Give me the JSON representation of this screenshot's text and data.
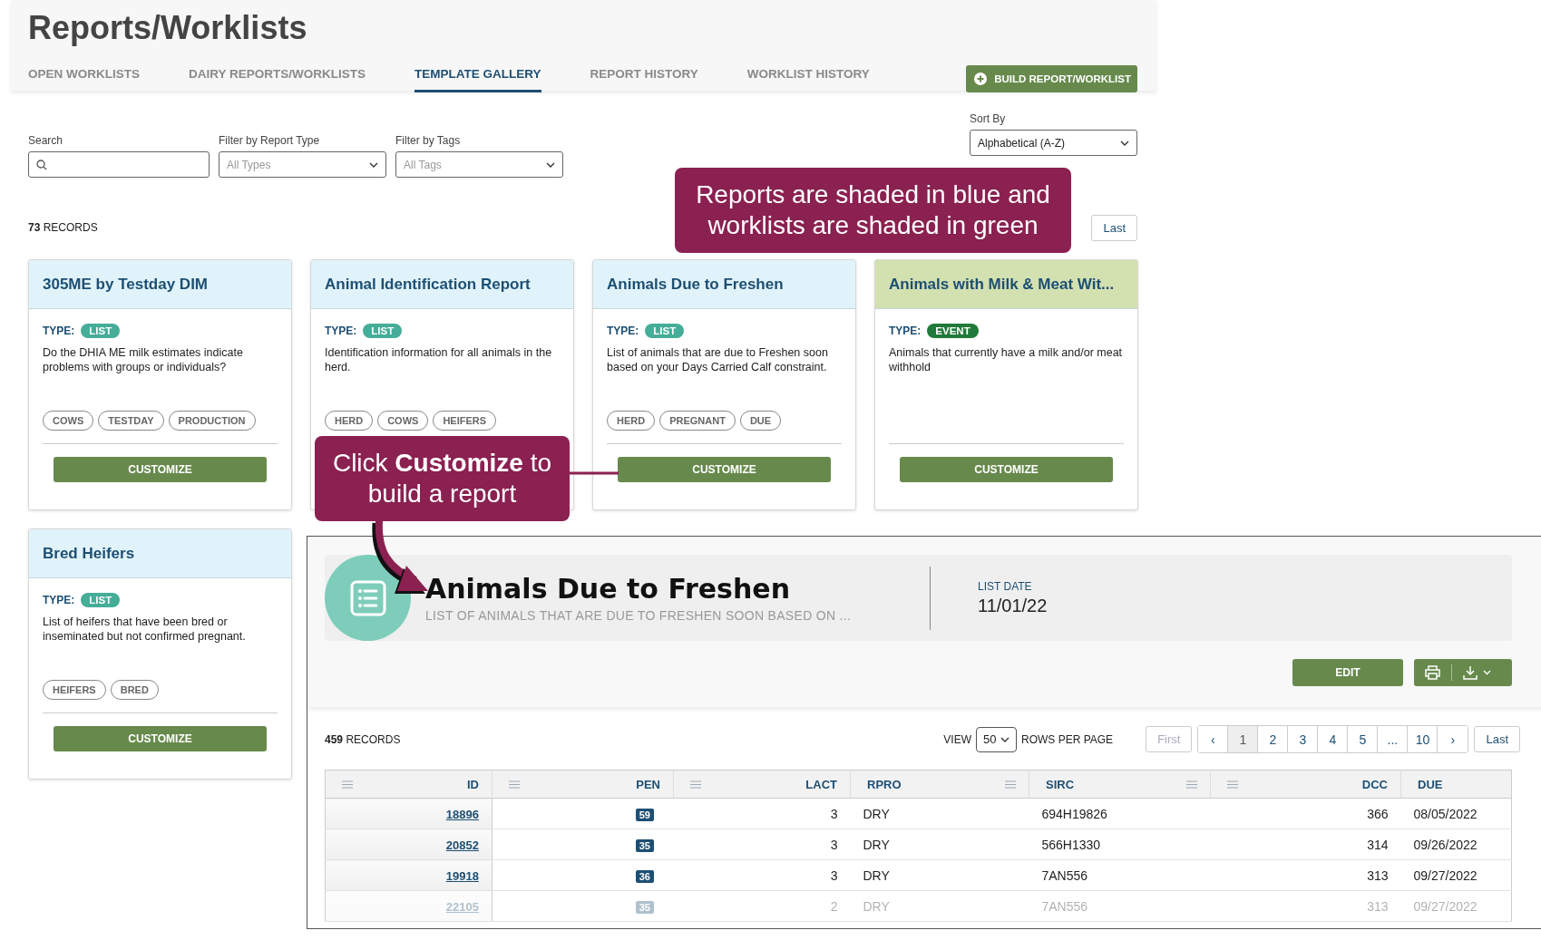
{
  "page": {
    "title": "Reports/Worklists"
  },
  "tabs": [
    {
      "label": "OPEN WORKLISTS",
      "selected": false
    },
    {
      "label": "DAIRY REPORTS/WORKLISTS",
      "selected": false
    },
    {
      "label": "TEMPLATE GALLERY",
      "selected": true
    },
    {
      "label": "REPORT HISTORY",
      "selected": false
    },
    {
      "label": "WORKLIST HISTORY",
      "selected": false
    }
  ],
  "build_button": "BUILD REPORT/WORKLIST",
  "filters": {
    "search": {
      "label": "Search"
    },
    "report_type": {
      "label": "Filter by Report Type",
      "value": "All Types"
    },
    "tags": {
      "label": "Filter by Tags",
      "value": "All Tags"
    },
    "sort": {
      "label": "Sort By",
      "value": "Alphabetical (A-Z)"
    }
  },
  "records": {
    "count": "73",
    "label": "RECORDS"
  },
  "pagination": [
    {
      "label": "Last"
    }
  ],
  "cards": [
    {
      "title": "305ME by Testday DIM",
      "kind": "report",
      "type_label": "TYPE:",
      "type": {
        "label": "LIST",
        "kind": "list"
      },
      "description": "Do the DHIA ME milk estimates indicate problems with groups or individuals?",
      "tags": [
        "COWS",
        "TESTDAY",
        "PRODUCTION"
      ],
      "button": "CUSTOMIZE"
    },
    {
      "title": "Animal Identification Report",
      "kind": "report",
      "type_label": "TYPE:",
      "type": {
        "label": "LIST",
        "kind": "list"
      },
      "description": "Identification information for all animals in the herd.",
      "tags": [
        "HERD",
        "COWS",
        "HEIFERS"
      ]
    },
    {
      "title": "Animals Due to Freshen",
      "kind": "report",
      "type_label": "TYPE:",
      "type": {
        "label": "LIST",
        "kind": "list"
      },
      "description": "List of animals that are due to Freshen soon based on your Days Carried Calf constraint.",
      "tags": [
        "HERD",
        "PREGNANT",
        "DUE"
      ],
      "button": "CUSTOMIZE"
    },
    {
      "title": "Animals with Milk & Meat Wit...",
      "kind": "worklist",
      "type_label": "TYPE:",
      "type": {
        "label": "EVENT",
        "kind": "event"
      },
      "description": "Animals that currently have a milk and/or meat withhold",
      "button": "CUSTOMIZE"
    },
    {
      "title": "Bred Heifers",
      "kind": "report",
      "type_label": "TYPE:",
      "type": {
        "label": "LIST",
        "kind": "list"
      },
      "description": "List of heifers that have been bred or inseminated but not confirmed pregnant.",
      "tags": [
        "HEIFERS",
        "BRED"
      ],
      "button": "CUSTOMIZE"
    }
  ],
  "detail_panel": {
    "title": "Animals Due to Freshen",
    "subtitle": "LIST OF ANIMALS THAT ARE DUE TO FRESHEN SOON BASED ON ...",
    "list_date": {
      "label": "LIST DATE",
      "value": "11/01/22"
    },
    "edit_button": "EDIT",
    "records": {
      "count": "459",
      "label": "RECORDS"
    },
    "view": {
      "label": "VIEW",
      "value": "50",
      "suffix": "ROWS PER PAGE"
    },
    "first_button": {
      "label": "First",
      "disabled": true
    },
    "pages": [
      {
        "label": "‹",
        "selected": false
      },
      {
        "label": "1",
        "selected": true
      },
      {
        "label": "2",
        "selected": false
      },
      {
        "label": "3",
        "selected": false
      },
      {
        "label": "4",
        "selected": false
      },
      {
        "label": "5",
        "selected": false
      },
      {
        "label": "...",
        "selected": false
      },
      {
        "label": "10",
        "selected": false
      },
      {
        "label": "›",
        "selected": false
      }
    ],
    "last_button": {
      "label": "Last",
      "disabled": false
    },
    "table": {
      "columns": [
        {
          "label": "ID",
          "kind": "number",
          "menu": true
        },
        {
          "label": "PEN",
          "kind": "number",
          "menu": true
        },
        {
          "label": "LACT",
          "kind": "number",
          "menu": true
        },
        {
          "label": "RPRO",
          "kind": "text",
          "menu": true
        },
        {
          "label": "SIRC",
          "kind": "text",
          "menu": true
        },
        {
          "label": "DCC",
          "kind": "number",
          "menu": true
        },
        {
          "label": "DUE",
          "kind": "text",
          "menu": false
        }
      ],
      "rows": [
        {
          "cells": [
            "18896",
            "59",
            "3",
            "DRY",
            "694H19826",
            "366",
            "08/05/2022"
          ],
          "faded": false
        },
        {
          "cells": [
            "20852",
            "35",
            "3",
            "DRY",
            "566H1330",
            "314",
            "09/26/2022"
          ],
          "faded": false
        },
        {
          "cells": [
            "19918",
            "36",
            "3",
            "DRY",
            "7AN556",
            "313",
            "09/27/2022"
          ],
          "faded": false
        },
        {
          "cells": [
            "22105",
            "35",
            "2",
            "DRY",
            "7AN556",
            "313",
            "09/27/2022"
          ],
          "faded": true
        }
      ]
    }
  },
  "callouts": [
    {
      "text": "Reports are shaded in blue and worklists are shaded in green"
    },
    {
      "text": "Click **Customize** to build a report"
    }
  ]
}
